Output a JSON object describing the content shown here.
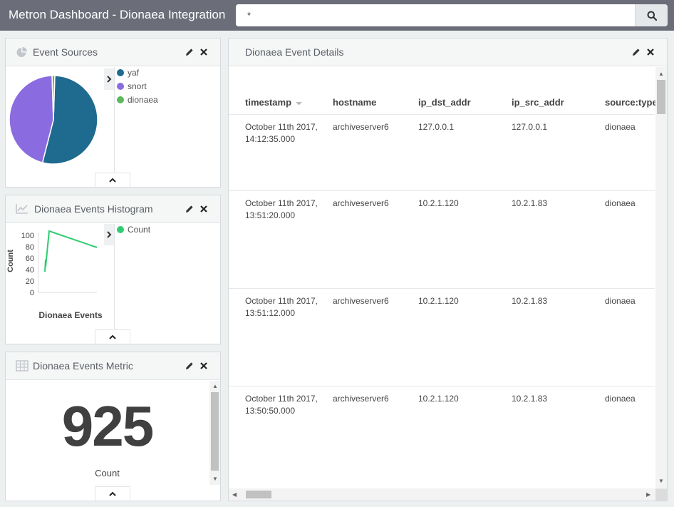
{
  "header": {
    "title": "Metron Dashboard - Dionaea Integration",
    "search_value": "*"
  },
  "panels": {
    "event_sources": {
      "title": "Event Sources",
      "legend": [
        {
          "label": "yaf",
          "color": "#1f6a8f"
        },
        {
          "label": "snort",
          "color": "#8a6be0"
        },
        {
          "label": "dionaea",
          "color": "#5cb85c"
        }
      ],
      "pie_values": [
        53.5,
        45.5,
        1.0
      ]
    },
    "histogram": {
      "title": "Dionaea Events Histogram",
      "y_label": "Count",
      "x_label": "Dionaea Events",
      "y_ticks": [
        "100",
        "80",
        "60",
        "40",
        "20",
        "0"
      ],
      "legend": [
        {
          "label": "Count",
          "color": "#2ecc71"
        }
      ]
    },
    "metric": {
      "title": "Dionaea Events Metric",
      "value": "925",
      "label": "Count"
    },
    "details": {
      "title": "Dionaea Event Details",
      "columns": [
        "timestamp",
        "hostname",
        "ip_dst_addr",
        "ip_src_addr",
        "source:type"
      ],
      "rows": [
        {
          "ts1": "October 11th 2017,",
          "ts2": "14:12:35.000",
          "hostname": "archiveserver6",
          "dst": "127.0.0.1",
          "src": "127.0.0.1",
          "type": "dionaea"
        },
        {
          "ts1": "October 11th 2017,",
          "ts2": "13:51:20.000",
          "hostname": "archiveserver6",
          "dst": "10.2.1.120",
          "src": "10.2.1.83",
          "type": "dionaea"
        },
        {
          "ts1": "October 11th 2017,",
          "ts2": "13:51:12.000",
          "hostname": "archiveserver6",
          "dst": "10.2.1.120",
          "src": "10.2.1.83",
          "type": "dionaea"
        },
        {
          "ts1": "October 11th 2017,",
          "ts2": "13:50:50.000",
          "hostname": "archiveserver6",
          "dst": "10.2.1.120",
          "src": "10.2.1.83",
          "type": "dionaea"
        }
      ]
    }
  },
  "icons": [
    "pie-chart-icon",
    "line-chart-icon",
    "table-icon",
    "search-icon",
    "pencil-icon",
    "close-icon",
    "chevron-right-icon",
    "chevron-up-icon",
    "sort-caret-icon"
  ]
}
